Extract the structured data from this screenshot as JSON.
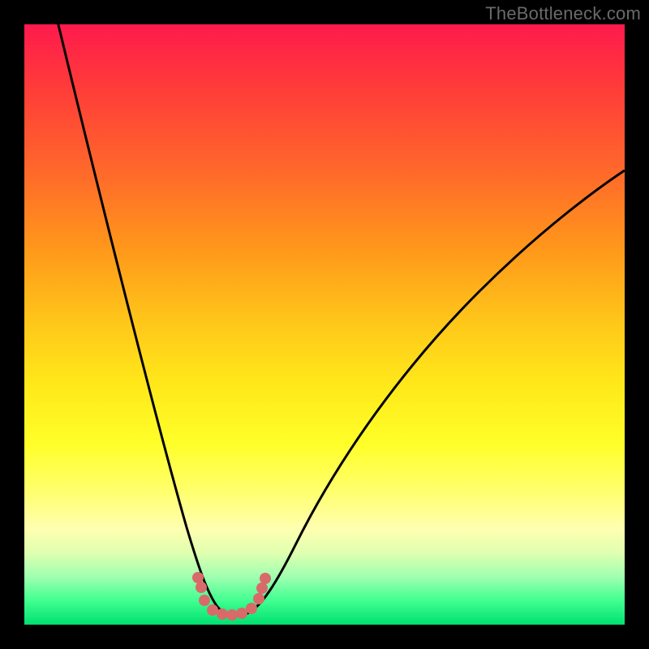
{
  "watermark": "TheBottleneck.com",
  "chart_data": {
    "type": "line",
    "title": "",
    "xlabel": "",
    "ylabel": "",
    "xlim": [
      0,
      100
    ],
    "ylim": [
      0,
      100
    ],
    "series": [
      {
        "name": "black-curve",
        "color": "#000000",
        "x": [
          5,
          10,
          15,
          20,
          25,
          28,
          30,
          32,
          34,
          36,
          38,
          40,
          45,
          50,
          55,
          60,
          65,
          70,
          75,
          80,
          85,
          90,
          95,
          100
        ],
        "y": [
          100,
          80,
          60,
          41,
          24,
          14,
          8,
          4,
          2,
          1.5,
          2,
          4,
          12,
          22,
          32,
          41,
          49,
          56,
          62,
          67,
          71,
          74,
          77,
          79
        ]
      },
      {
        "name": "pink-trough-dots",
        "color": "#d96a6a",
        "type": "scatter",
        "x": [
          29,
          30.5,
          31,
          32.5,
          34,
          35.5,
          37,
          38.5,
          39,
          40.5
        ],
        "y": [
          7,
          4,
          2,
          1.5,
          1.5,
          1.5,
          1.5,
          2,
          4,
          7
        ]
      }
    ],
    "gradient_stops": [
      {
        "pos": 0,
        "color": "#ff1a4d"
      },
      {
        "pos": 25,
        "color": "#ff6a2a"
      },
      {
        "pos": 50,
        "color": "#ffc81a"
      },
      {
        "pos": 75,
        "color": "#ffff70"
      },
      {
        "pos": 100,
        "color": "#00e070"
      }
    ]
  }
}
